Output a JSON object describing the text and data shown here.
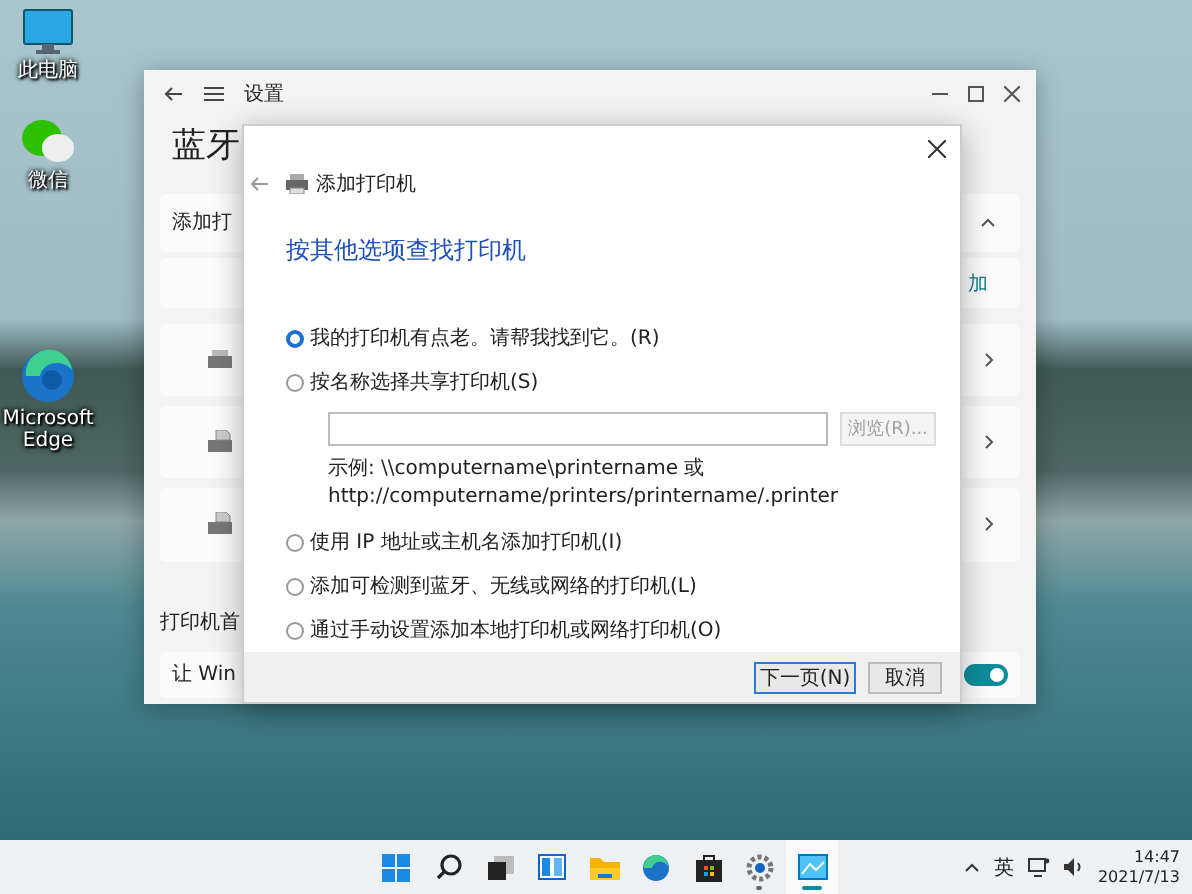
{
  "desktop_icons": [
    {
      "label": "此电脑",
      "kind": "monitor"
    },
    {
      "label": "微信",
      "kind": "chat"
    },
    {
      "label": "Microsoft Edge",
      "kind": "edge"
    }
  ],
  "settings_window": {
    "title": "设置",
    "heading": "蓝牙",
    "add_card_label": "添加打",
    "add_link": "加",
    "devices": [
      {
        "kind": "printer"
      },
      {
        "kind": "fax"
      },
      {
        "kind": "fax"
      }
    ],
    "section_heading": "打印机首",
    "toggle_row": {
      "label": "让 Win",
      "on": true
    }
  },
  "dialog": {
    "title": "添加打印机",
    "heading": "按其他选项查找打印机",
    "options": [
      {
        "label": "我的打印机有点老。请帮我找到它。(R)",
        "kind": "plain",
        "selected": true
      },
      {
        "label": "按名称选择共享打印机(S)",
        "kind": "shared",
        "selected": false
      },
      {
        "label": "使用 IP 地址或主机名添加打印机(I)",
        "kind": "plain",
        "selected": false
      },
      {
        "label": "添加可检测到蓝牙、无线或网络的打印机(L)",
        "kind": "plain",
        "selected": false
      },
      {
        "label": "通过手动设置添加本地打印机或网络打印机(O)",
        "kind": "plain",
        "selected": false
      }
    ],
    "browse_button": {
      "label": "浏览(R)...",
      "disabled": true
    },
    "example_lines": [
      "示例: \\\\computername\\printername 或",
      "http://computername/printers/printername/.printer"
    ],
    "buttons": [
      {
        "label": "下一页(N)",
        "kind": "primary"
      },
      {
        "label": "取消",
        "kind": "secondary"
      }
    ]
  },
  "taskbar": {
    "apps": [
      {
        "kind": "start",
        "running": false,
        "active": false
      },
      {
        "kind": "search",
        "running": false,
        "active": false
      },
      {
        "kind": "taskview",
        "running": false,
        "active": false
      },
      {
        "kind": "widgets",
        "running": false,
        "active": false
      },
      {
        "kind": "folder",
        "running": false,
        "active": false
      },
      {
        "kind": "edge",
        "running": false,
        "active": false
      },
      {
        "kind": "store",
        "running": false,
        "active": false
      },
      {
        "kind": "settings",
        "running": true,
        "active": false
      },
      {
        "kind": "control",
        "running": true,
        "active": true
      }
    ],
    "language": "英",
    "time": "14:47",
    "date": "2021/7/13"
  }
}
